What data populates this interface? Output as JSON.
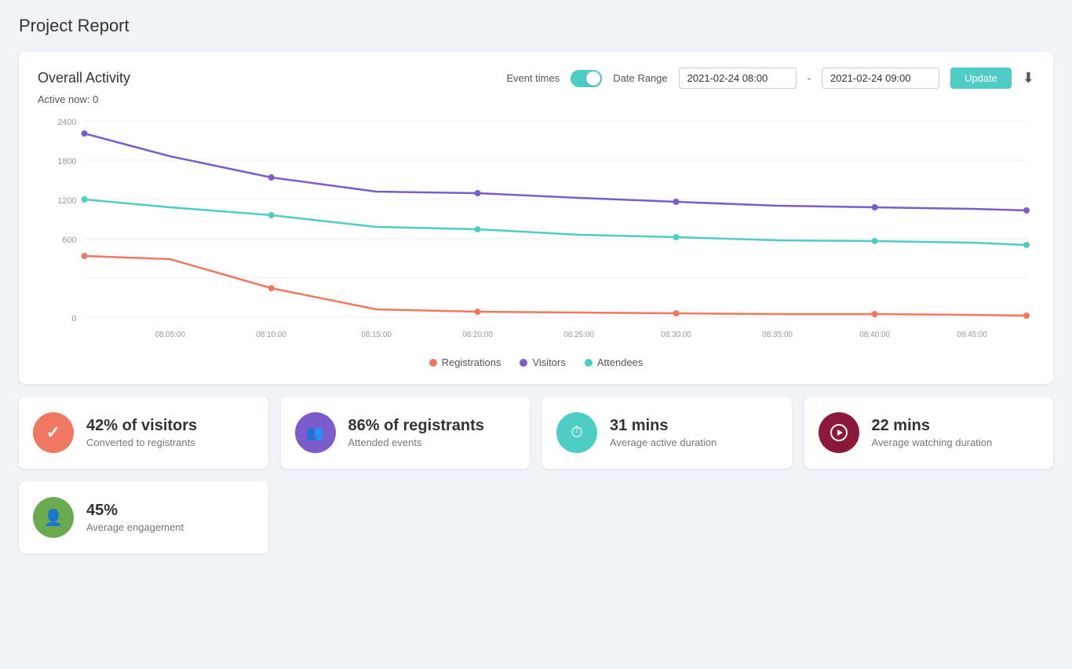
{
  "page": {
    "title": "Project Report"
  },
  "chart": {
    "title": "Overall Activity",
    "active_now_label": "Active now:",
    "active_now_value": "0",
    "event_times_label": "Event times",
    "date_range_label": "Date Range",
    "date_from": "2021-02-24 08:00",
    "date_to": "2021-02-24 09:00",
    "update_btn_label": "Update",
    "y_axis": [
      "2400",
      "1800",
      "1200",
      "600",
      "0"
    ],
    "x_axis": [
      "08:05:00",
      "08:10:00",
      "08:15:00",
      "08:20:00",
      "08:25:00",
      "08:30:00",
      "08:35:00",
      "08:40:00",
      "08:45:00"
    ],
    "legend": [
      {
        "label": "Registrations",
        "color": "#f07860"
      },
      {
        "label": "Visitors",
        "color": "#7c5ccc"
      },
      {
        "label": "Attendees",
        "color": "#4ecdc4"
      }
    ]
  },
  "stats": [
    {
      "icon": "check",
      "icon_color": "#f07860",
      "value": "42% of visitors",
      "label": "Converted to registrants"
    },
    {
      "icon": "users",
      "icon_color": "#7c5ccc",
      "value": "86% of registrants",
      "label": "Attended events"
    },
    {
      "icon": "clock",
      "icon_color": "#4ecdc4",
      "value": "31 mins",
      "label": "Average active duration"
    },
    {
      "icon": "play",
      "icon_color": "#8b1a3a",
      "value": "22 mins",
      "label": "Average watching duration"
    }
  ],
  "stats_bottom": [
    {
      "icon": "person",
      "icon_color": "#6aab4f",
      "value": "45%",
      "label": "Average engagement"
    }
  ]
}
